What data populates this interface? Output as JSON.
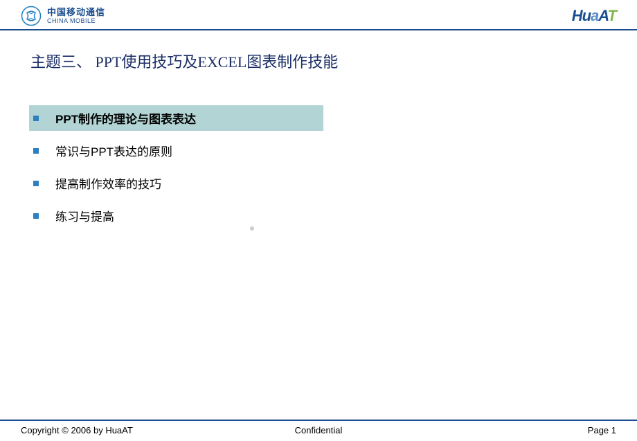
{
  "header": {
    "logo_left_cn": "中国移动通信",
    "logo_left_en": "CHINA MOBILE",
    "logo_right_h": "Hu",
    "logo_right_a": "a",
    "logo_right_a2": "A",
    "logo_right_t": "T"
  },
  "title": "主题三、 PPT使用技巧及EXCEL图表制作技能",
  "bullets": [
    {
      "text": "PPT制作的理论与图表表达",
      "highlighted": true
    },
    {
      "text": "常识与PPT表达的原则",
      "highlighted": false
    },
    {
      "text": "提高制作效率的技巧",
      "highlighted": false
    },
    {
      "text": "练习与提高",
      "highlighted": false
    }
  ],
  "footer": {
    "left": "Copyright © 2006 by HuaAT",
    "center": "Confidential",
    "right": "Page 1"
  }
}
